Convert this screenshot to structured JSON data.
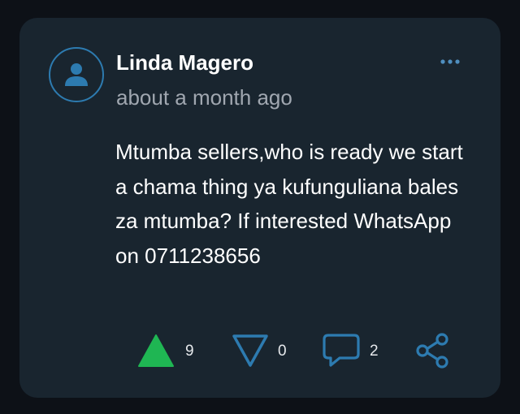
{
  "post": {
    "author": "Linda Magero",
    "time": "about a month ago",
    "text": "Mtumba sellers,who is ready we start a chama thing ya kufunguliana bales za mtumba? If interested WhatsApp on 0711238656"
  },
  "actions": {
    "upvotes": "9",
    "downvotes": "0",
    "comments": "2"
  },
  "icons": {
    "avatar": "user-icon",
    "more": "more-horizontal-icon",
    "upvote": "triangle-up-filled-icon",
    "downvote": "triangle-down-outline-icon",
    "comment": "comment-bubble-icon",
    "share": "share-icon"
  },
  "colors": {
    "background": "#0d1117",
    "card": "#19252f",
    "accent": "#2d7bb0",
    "upvote": "#1fb653",
    "icon_outline": "#2d7bb0",
    "text": "#ffffff",
    "muted": "#a0a7b0"
  }
}
